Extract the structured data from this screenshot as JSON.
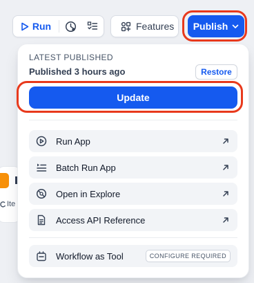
{
  "toolbar": {
    "run_label": "Run",
    "features_label": "Features",
    "publish_label": "Publish"
  },
  "background": {
    "card_text": "Ite"
  },
  "panel": {
    "section_title": "LATEST PUBLISHED",
    "published_status": "Published 3 hours ago",
    "restore_label": "Restore",
    "update_label": "Update",
    "items": [
      {
        "label": "Run App",
        "icon": "play-circle-icon"
      },
      {
        "label": "Batch Run App",
        "icon": "batch-list-icon"
      },
      {
        "label": "Open in Explore",
        "icon": "explore-compass-icon"
      },
      {
        "label": "Access API Reference",
        "icon": "document-icon"
      }
    ],
    "tool": {
      "label": "Workflow as Tool",
      "badge": "CONFIGURE REQUIRED"
    }
  },
  "colors": {
    "accent": "#155aef",
    "highlight": "#e8391c"
  }
}
